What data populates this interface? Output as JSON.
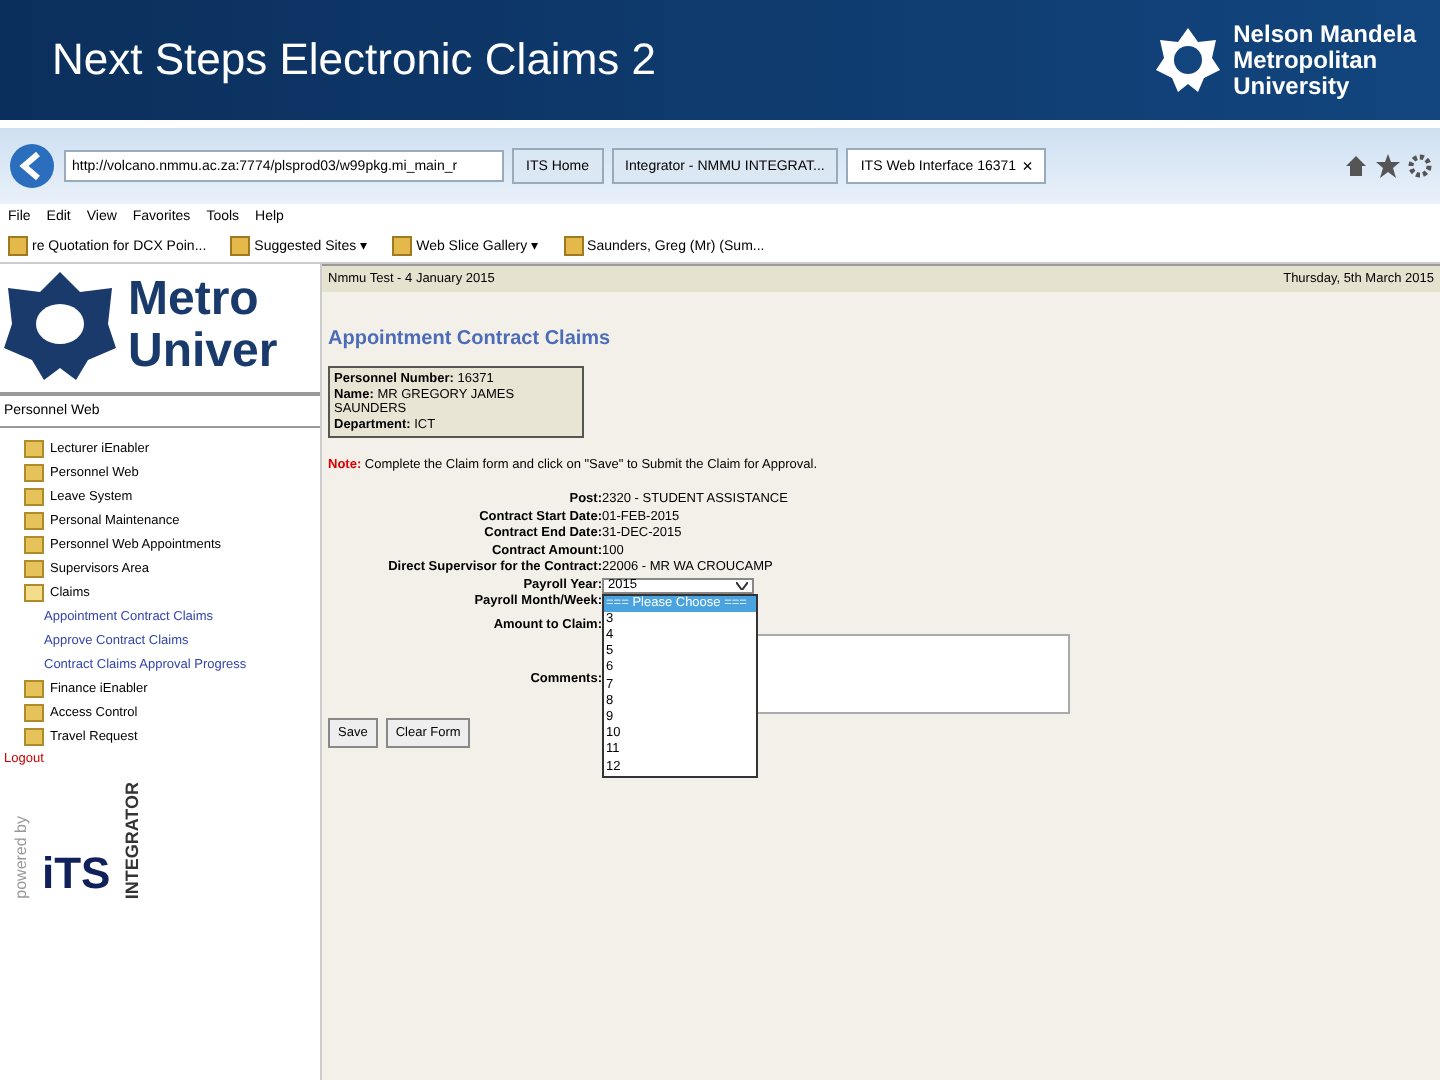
{
  "slide": {
    "title": "Next Steps Electronic Claims 2",
    "logo_lines": [
      "Nelson Mandela",
      "Metropolitan",
      "University"
    ]
  },
  "browser": {
    "address": "http://volcano.nmmu.ac.za:7774/plsprod03/w99pkg.mi_main_r",
    "tabs": [
      {
        "label": "ITS Home",
        "selected": false
      },
      {
        "label": "Integrator - NMMU INTEGRAT...",
        "selected": false
      },
      {
        "label": "ITS Web Interface 16371",
        "selected": true
      }
    ],
    "close_tab": "×",
    "menu": [
      "File",
      "Edit",
      "View",
      "Favorites",
      "Tools",
      "Help"
    ],
    "favorites": [
      "re Quotation for DCX Poin...",
      "Suggested Sites ▾",
      "Web Slice Gallery ▾",
      "Saunders, Greg (Mr) (Sum..."
    ]
  },
  "sidebar": {
    "logo_text": [
      "Metro",
      "Univer"
    ],
    "heading": "Personnel Web",
    "items": [
      {
        "label": "Lecturer iEnabler",
        "expanded": false
      },
      {
        "label": "Personnel Web",
        "expanded": false
      },
      {
        "label": "Leave System",
        "expanded": false
      },
      {
        "label": "Personal Maintenance",
        "expanded": false
      },
      {
        "label": "Personnel Web Appointments",
        "expanded": false
      },
      {
        "label": "Supervisors Area",
        "expanded": false
      },
      {
        "label": "Claims",
        "expanded": true,
        "children": [
          {
            "label": "Appointment Contract Claims"
          },
          {
            "label": "Approve Contract Claims"
          },
          {
            "label": "Contract Claims Approval Progress"
          }
        ]
      },
      {
        "label": "Finance iEnabler",
        "expanded": false
      },
      {
        "label": "Access Control",
        "expanded": false
      },
      {
        "label": "Travel Request",
        "expanded": false
      }
    ],
    "logout": "Logout",
    "powered_by": "powered by",
    "brand": "iTS",
    "brand_sub": "INTEGRATOR"
  },
  "main": {
    "header_left": "Nmmu Test - 4 January 2015",
    "header_right": "Thursday, 5th March 2015",
    "title": "Appointment Contract Claims",
    "person": [
      {
        "label": "Personnel Number:",
        "value": "16371"
      },
      {
        "label": "Name:",
        "value": "MR GREGORY JAMES SAUNDERS"
      },
      {
        "label": "Department:",
        "value": "ICT"
      }
    ],
    "note_label": "Note:",
    "note": "Complete the Claim form and click on \"Save\" to Submit the Claim for Approval.",
    "details": [
      {
        "label": "Post:",
        "value": "2320 - STUDENT ASSISTANCE"
      },
      {
        "label": "Contract Start Date:",
        "value": "01-FEB-2015"
      },
      {
        "label": "Contract End Date:",
        "value": "31-DEC-2015"
      },
      {
        "label": "Contract Amount:",
        "value": "100"
      },
      {
        "label": "Direct Supervisor for the Contract:",
        "value": "22006 - MR WA CROUCAMP"
      }
    ],
    "payroll_year": {
      "label": "Payroll Year:",
      "value": "2015"
    },
    "payroll_month": {
      "label": "Payroll Month/Week:",
      "options": [
        {
          "label": "=== Please Choose ===",
          "selected": true
        },
        {
          "label": "3",
          "selected": false
        },
        {
          "label": "4",
          "selected": false
        },
        {
          "label": "5",
          "selected": false
        },
        {
          "label": "6",
          "selected": false
        },
        {
          "label": "7",
          "selected": false
        },
        {
          "label": "8",
          "selected": false
        },
        {
          "label": "9",
          "selected": false
        },
        {
          "label": "10",
          "selected": false
        },
        {
          "label": "11",
          "selected": false
        },
        {
          "label": "12",
          "selected": false
        }
      ]
    },
    "amount_label": "Amount to Claim:",
    "comments_label": "Comments:",
    "buttons": [
      "Save",
      "Clear Form"
    ]
  }
}
